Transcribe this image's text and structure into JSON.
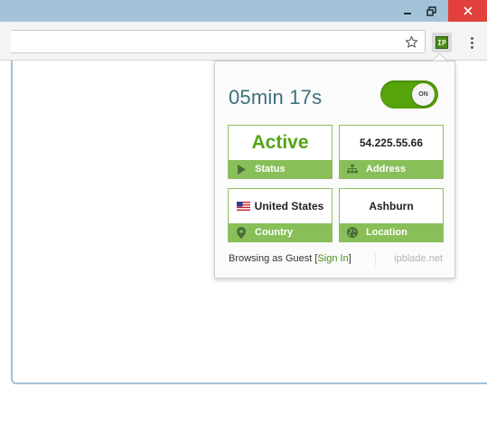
{
  "window": {
    "minimize_glyph": "–",
    "maximize_glyph": "❐",
    "close_glyph": "✕"
  },
  "toolbar": {
    "address_value": "",
    "bookmark_icon": "star-icon",
    "extension_badge": "IP"
  },
  "popup": {
    "timer": "05min 17s",
    "toggle": {
      "label": "ON",
      "state": "on"
    },
    "cards": {
      "status": {
        "value": "Active",
        "label": "Status",
        "icon": "play-icon"
      },
      "address": {
        "value": "54.225.55.66",
        "label": "Address",
        "icon": "network-icon"
      },
      "country": {
        "value": "United States",
        "label": "Country",
        "icon": "map-pin-icon"
      },
      "location": {
        "value": "Ashburn",
        "label": "Location",
        "icon": "globe-icon"
      }
    },
    "footer": {
      "prefix": "Browsing as Guest [",
      "sign_in": "Sign In",
      "suffix": "]",
      "brand": "ipblade.net"
    }
  },
  "colors": {
    "accent_green": "#56a30c",
    "card_footer": "#88bf59",
    "timer_text": "#3d6f7c",
    "titlebar": "#a3c2d7",
    "close": "#e2403a"
  }
}
